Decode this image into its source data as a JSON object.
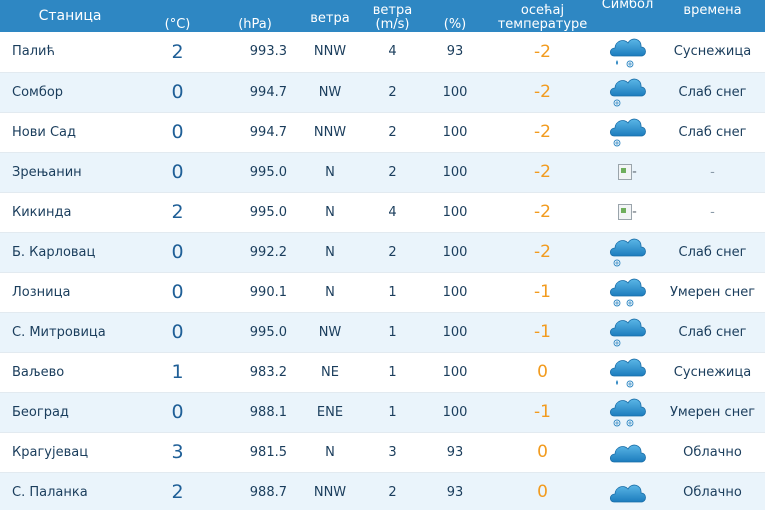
{
  "headers": {
    "station": "Станица",
    "temp": [
      "",
      "(°C)"
    ],
    "pressure": [
      "",
      "(hPa)"
    ],
    "wind_dir": [
      "",
      "ветра"
    ],
    "wind_speed": [
      "ветра",
      "(m/s)"
    ],
    "humidity": [
      "",
      "(%)"
    ],
    "feels_like": [
      "осећај",
      "температуре"
    ],
    "symbol": [
      "Симбол",
      ""
    ],
    "description": [
      "времена",
      ""
    ]
  },
  "rows": [
    {
      "station": "Палић",
      "temp": "2",
      "pressure": "993.3",
      "wind_dir": "NNW",
      "wind_speed": "4",
      "humidity": "93",
      "feels_like": "-2",
      "icon": "sleet-icon",
      "description": "Суснежица"
    },
    {
      "station": "Сомбор",
      "temp": "0",
      "pressure": "994.7",
      "wind_dir": "NW",
      "wind_speed": "2",
      "humidity": "100",
      "feels_like": "-2",
      "icon": "light-snow-icon",
      "description": "Слаб снег"
    },
    {
      "station": "Нови Сад",
      "temp": "0",
      "pressure": "994.7",
      "wind_dir": "NNW",
      "wind_speed": "2",
      "humidity": "100",
      "feels_like": "-2",
      "icon": "light-snow-icon",
      "description": "Слаб снег"
    },
    {
      "station": "Зрењанин",
      "temp": "0",
      "pressure": "995.0",
      "wind_dir": "N",
      "wind_speed": "2",
      "humidity": "100",
      "feels_like": "-2",
      "icon": "broken-image-icon",
      "icon_alt": "-",
      "description": "-"
    },
    {
      "station": "Кикинда",
      "temp": "2",
      "pressure": "995.0",
      "wind_dir": "N",
      "wind_speed": "4",
      "humidity": "100",
      "feels_like": "-2",
      "icon": "broken-image-icon",
      "icon_alt": "-",
      "description": "-"
    },
    {
      "station": "Б. Карловац",
      "temp": "0",
      "pressure": "992.2",
      "wind_dir": "N",
      "wind_speed": "2",
      "humidity": "100",
      "feels_like": "-2",
      "icon": "light-snow-icon",
      "description": "Слаб снег"
    },
    {
      "station": "Лозница",
      "temp": "0",
      "pressure": "990.1",
      "wind_dir": "N",
      "wind_speed": "1",
      "humidity": "100",
      "feels_like": "-1",
      "icon": "moderate-snow-icon",
      "description": "Умерен снег"
    },
    {
      "station": "С. Митровица",
      "temp": "0",
      "pressure": "995.0",
      "wind_dir": "NW",
      "wind_speed": "1",
      "humidity": "100",
      "feels_like": "-1",
      "icon": "light-snow-icon",
      "description": "Слаб снег"
    },
    {
      "station": "Ваљево",
      "temp": "1",
      "pressure": "983.2",
      "wind_dir": "NE",
      "wind_speed": "1",
      "humidity": "100",
      "feels_like": "0",
      "icon": "sleet-icon",
      "description": "Суснежица"
    },
    {
      "station": "Београд",
      "temp": "0",
      "pressure": "988.1",
      "wind_dir": "ENE",
      "wind_speed": "1",
      "humidity": "100",
      "feels_like": "-1",
      "icon": "moderate-snow-icon",
      "description": "Умерен снег"
    },
    {
      "station": "Крагујевац",
      "temp": "3",
      "pressure": "981.5",
      "wind_dir": "N",
      "wind_speed": "3",
      "humidity": "93",
      "feels_like": "0",
      "icon": "cloudy-icon",
      "description": "Облачно"
    },
    {
      "station": "С. Паланка",
      "temp": "2",
      "pressure": "988.7",
      "wind_dir": "NNW",
      "wind_speed": "2",
      "humidity": "93",
      "feels_like": "0",
      "icon": "cloudy-icon",
      "description": "Облачно"
    }
  ],
  "colors": {
    "header_bg": "#2e87c3",
    "header_text": "#ffffff",
    "row_alt_bg": "#eaf4fb",
    "temp_text": "#1f5f97",
    "feels_like_text": "#f29b1e",
    "cloud_top": "#5bb6e6",
    "cloud_bottom": "#1c7cbd"
  }
}
